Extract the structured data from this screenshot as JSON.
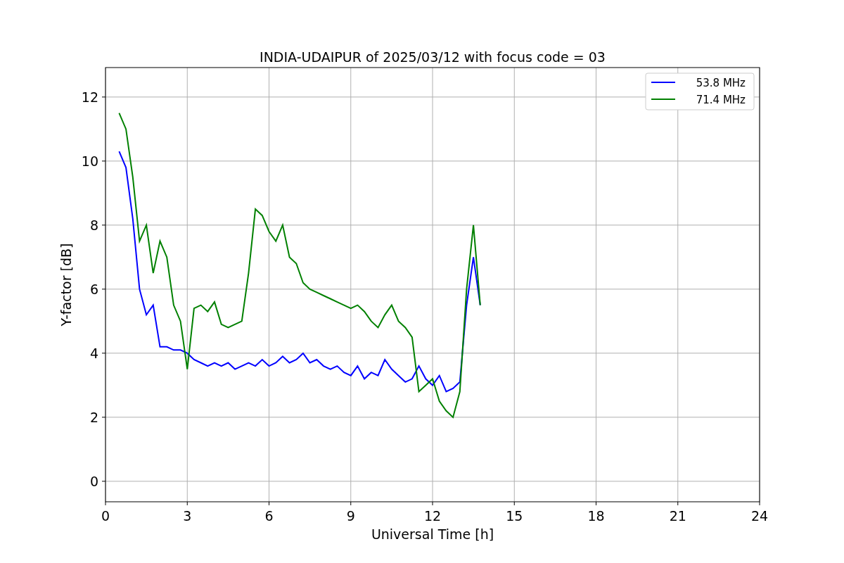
{
  "figure": {
    "chart_data": {
      "type": "line",
      "title": "INDIA-UDAIPUR of 2025/03/12 with focus code = 03",
      "xlabel": "Universal Time [h]",
      "ylabel": "Y-factor [dB]",
      "x": [
        0.5,
        0.75,
        1.0,
        1.25,
        1.5,
        1.75,
        2.0,
        2.25,
        2.5,
        2.75,
        3.0,
        3.25,
        3.5,
        3.75,
        4.0,
        4.25,
        4.5,
        4.75,
        5.0,
        5.25,
        5.5,
        5.75,
        6.0,
        6.25,
        6.5,
        6.75,
        7.0,
        7.25,
        7.5,
        7.75,
        8.0,
        8.25,
        8.5,
        8.75,
        9.0,
        9.25,
        9.5,
        9.75,
        10.0,
        10.25,
        10.5,
        10.75,
        11.0,
        11.25,
        11.5,
        11.75,
        12.0,
        12.25,
        12.5,
        12.75,
        13.0,
        13.25,
        13.5,
        13.75
      ],
      "series": [
        {
          "name": "53.8 MHz",
          "color": "#0000ff",
          "values": [
            10.3,
            9.8,
            8.2,
            6.0,
            5.2,
            5.5,
            4.2,
            4.2,
            4.1,
            4.1,
            4.0,
            3.8,
            3.7,
            3.6,
            3.7,
            3.6,
            3.7,
            3.5,
            3.6,
            3.7,
            3.6,
            3.8,
            3.6,
            3.7,
            3.9,
            3.7,
            3.8,
            4.0,
            3.7,
            3.8,
            3.6,
            3.5,
            3.6,
            3.4,
            3.3,
            3.6,
            3.2,
            3.4,
            3.3,
            3.8,
            3.5,
            3.3,
            3.1,
            3.2,
            3.6,
            3.2,
            3.0,
            3.3,
            2.8,
            2.9,
            3.1,
            5.5,
            7.0,
            5.5
          ]
        },
        {
          "name": "71.4 MHz",
          "color": "#008000",
          "values": [
            11.5,
            11.0,
            9.5,
            7.5,
            8.0,
            6.5,
            7.5,
            7.0,
            5.5,
            5.0,
            3.5,
            5.4,
            5.5,
            5.3,
            5.6,
            4.9,
            4.8,
            4.9,
            5.0,
            6.5,
            8.5,
            8.3,
            7.8,
            7.5,
            8.0,
            7.0,
            6.8,
            6.2,
            6.0,
            5.9,
            5.8,
            5.7,
            5.6,
            5.5,
            5.4,
            5.5,
            5.3,
            5.0,
            4.8,
            5.2,
            5.5,
            5.0,
            4.8,
            4.5,
            2.8,
            3.0,
            3.2,
            2.5,
            2.2,
            2.0,
            2.8,
            6.0,
            8.0,
            5.5
          ]
        }
      ],
      "grid": true,
      "legend": true,
      "xlim": [
        0,
        24
      ],
      "ylim": [
        -0.64,
        12.92
      ],
      "xticks": [
        0,
        3,
        6,
        9,
        12,
        15,
        18,
        21,
        24
      ],
      "yticks": [
        0,
        2,
        4,
        6,
        8,
        10,
        12
      ]
    }
  }
}
